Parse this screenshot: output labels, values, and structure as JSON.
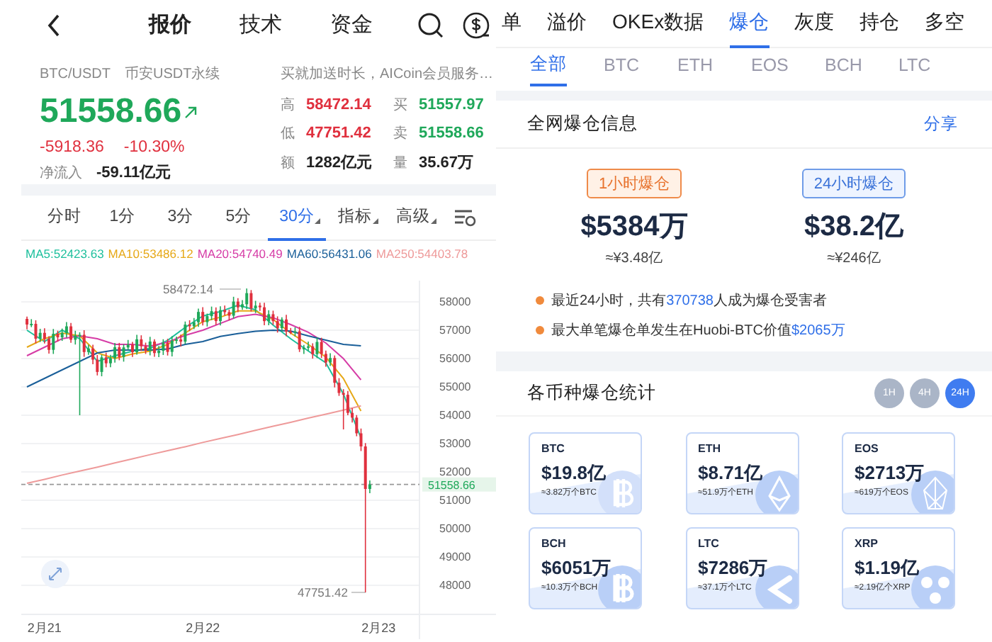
{
  "quote_screen": {
    "tabs": [
      {
        "label": "报价",
        "selected": true
      },
      {
        "label": "技术",
        "selected": false
      },
      {
        "label": "资金",
        "selected": false
      }
    ],
    "pair": "BTC/USDT",
    "market": "币安USDT永续",
    "promo": "买就加送时长，AICoin会员服务…",
    "price": "51558.66",
    "change": "-5918.36",
    "change_pct": "-10.30%",
    "net_inflow": {
      "label": "净流入",
      "value": "-59.11亿元"
    },
    "stats": [
      {
        "label": "高",
        "value": "58472.14",
        "color": "#e0303e"
      },
      {
        "label": "买",
        "value": "51557.97",
        "color": "#1fa85a"
      },
      {
        "label": "低",
        "value": "47751.42",
        "color": "#e0303e"
      },
      {
        "label": "卖",
        "value": "51558.66",
        "color": "#1fa85a"
      },
      {
        "label": "额",
        "value": "1282亿元",
        "color": "#222222"
      },
      {
        "label": "量",
        "value": "35.67万",
        "color": "#222222"
      }
    ],
    "periods": [
      {
        "label": "分时",
        "selected": false,
        "dropdown": false
      },
      {
        "label": "1分",
        "selected": false,
        "dropdown": false
      },
      {
        "label": "3分",
        "selected": false,
        "dropdown": false
      },
      {
        "label": "5分",
        "selected": false,
        "dropdown": false
      },
      {
        "label": "30分",
        "selected": true,
        "dropdown": true
      },
      {
        "label": "指标",
        "selected": false,
        "dropdown": true
      },
      {
        "label": "高级",
        "selected": false,
        "dropdown": true
      }
    ],
    "ma_legend": [
      {
        "text": "MA5:52423.63",
        "color": "#1cbf9c"
      },
      {
        "text": "MA10:53486.12",
        "color": "#e6a817"
      },
      {
        "text": "MA20:54740.49",
        "color": "#d63ca6"
      },
      {
        "text": "MA60:56431.06",
        "color": "#1a5f99"
      },
      {
        "text": "MA250:54403.78",
        "color": "#ee9a9a"
      }
    ],
    "chart": {
      "high": "58472.14",
      "low": "47751.42",
      "last": "51558.66",
      "chart_data": {
        "type": "line",
        "categories": [
          null,
          "2月21",
          null,
          null,
          null,
          null,
          null,
          null,
          null,
          null,
          "2月22",
          null,
          null,
          null,
          null,
          null,
          null,
          null,
          null,
          null,
          "2月23"
        ],
        "grid": true,
        "ylim": [
          47000,
          58750
        ],
        "ref_lines": [
          {
            "axis": "y",
            "value": 51558.66
          }
        ],
        "yticks": [
          {
            "value": 58000,
            "label": "58000"
          },
          {
            "value": 57000,
            "label": "57000"
          },
          {
            "value": 56000,
            "label": "56000"
          },
          {
            "value": 55000,
            "label": "55000"
          },
          {
            "value": 54000,
            "label": "54000"
          },
          {
            "value": 53000,
            "label": "53000"
          },
          {
            "value": 52000,
            "label": "52000"
          },
          {
            "value": 51000,
            "label": "51000"
          },
          {
            "value": 50000,
            "label": "50000"
          },
          {
            "value": 49000,
            "label": "49000"
          },
          {
            "value": 48000,
            "label": "48000"
          }
        ],
        "series": [
          {
            "color": "#1cbf9c",
            "values": [
              57000,
              56600,
              57000,
              56700,
              55900,
              56100,
              56260,
              56360,
              56640,
              57100,
              57500,
              57660,
              57880,
              57720,
              57180,
              56700,
              56270,
              55850,
              54750,
              53200,
              null
            ]
          },
          {
            "color": "#e6a817",
            "values": [
              56400,
              56700,
              56900,
              56800,
              56200,
              56000,
              56160,
              56260,
              56500,
              56900,
              57300,
              57460,
              57680,
              57680,
              57380,
              56900,
              56500,
              56050,
              55300,
              54150,
              null
            ]
          },
          {
            "color": "#d63ca6",
            "values": [
              56100,
              56400,
              56700,
              56800,
              56700,
              56500,
              56500,
              56440,
              56580,
              56820,
              57000,
              57240,
              57480,
              57560,
              57440,
              57200,
              56930,
              56550,
              56000,
              55250,
              null
            ]
          },
          {
            "color": "#1a5f99",
            "values": [
              55000,
              55300,
              55600,
              55900,
              56200,
              56300,
              56300,
              56300,
              56340,
              56500,
              56600,
              56780,
              56880,
              56960,
              57000,
              56970,
              56800,
              56650,
              56500,
              56450,
              null
            ]
          },
          {
            "color": "#ee9a9a",
            "values": [
              51600,
              51740,
              51890,
              52030,
              52170,
              52320,
              52460,
              52610,
              52750,
              52890,
              53040,
              53180,
              53320,
              53470,
              53610,
              53750,
              53900,
              54040,
              54180,
              54330,
              null
            ]
          }
        ]
      }
    }
  },
  "liquidation_screen": {
    "top_tabs": [
      {
        "label": "单",
        "selected": false
      },
      {
        "label": "溢价",
        "selected": false
      },
      {
        "label": "OKEx数据",
        "selected": false
      },
      {
        "label": "爆仓",
        "selected": true
      },
      {
        "label": "灰度",
        "selected": false
      },
      {
        "label": "持仓",
        "selected": false
      },
      {
        "label": "多空",
        "selected": false
      }
    ],
    "coin_tabs": [
      {
        "label": "全部",
        "selected": true
      },
      {
        "label": "BTC",
        "selected": false
      },
      {
        "label": "ETH",
        "selected": false
      },
      {
        "label": "EOS",
        "selected": false
      },
      {
        "label": "BCH",
        "selected": false
      },
      {
        "label": "LTC",
        "selected": false
      }
    ],
    "section_title": "全网爆仓信息",
    "share": "分享",
    "totals": [
      {
        "kind": "hour",
        "badge": "1小时爆仓",
        "amount": "$5384万",
        "cny": "≈¥3.48亿"
      },
      {
        "kind": "day",
        "badge": "24小时爆仓",
        "amount": "$38.2亿",
        "cny": "≈¥246亿"
      }
    ],
    "notes": [
      {
        "before": "最近24小时，共有",
        "highlight": "370738",
        "after": "人成为爆仓受害者"
      },
      {
        "before": "最大单笔爆仓单发生在Huobi-BTC价值",
        "highlight": "$2065万"
      }
    ],
    "stats_title": "各币种爆仓统计",
    "ranges": [
      {
        "label": "1H",
        "selected": false
      },
      {
        "label": "4H",
        "selected": false
      },
      {
        "label": "24H",
        "selected": true
      }
    ],
    "coins": [
      {
        "symbol": "BTC",
        "amount": "$19.8亿",
        "qty": "≈3.82万个BTC"
      },
      {
        "symbol": "ETH",
        "amount": "$8.71亿",
        "qty": "≈51.9万个ETH"
      },
      {
        "symbol": "EOS",
        "amount": "$2713万",
        "qty": "≈619万个EOS"
      },
      {
        "symbol": "BCH",
        "amount": "$6051万",
        "qty": "≈10.3万个BCH"
      },
      {
        "symbol": "LTC",
        "amount": "$7286万",
        "qty": "≈37.1万个LTC"
      },
      {
        "symbol": "XRP",
        "amount": "$1.19亿",
        "qty": "≈2.19亿个XRP"
      }
    ]
  }
}
